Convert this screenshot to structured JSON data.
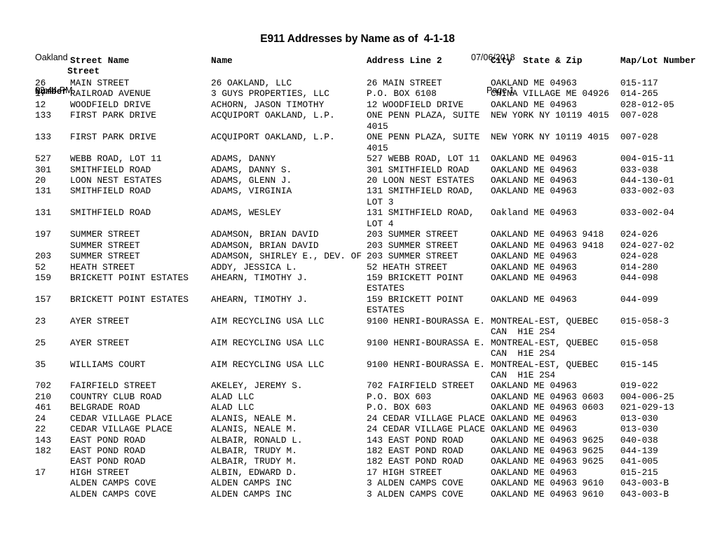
{
  "header": {
    "org": "Oakland",
    "time": "02:44 PM",
    "title": "E911 Addresses by Name as of  4-1-18",
    "run_date": "07/06/2018",
    "page_label": "Page 1"
  },
  "columns": {
    "street_number_line1": "Street",
    "street_number_line2": "Number",
    "street_name": "Street Name",
    "name": "Name",
    "address_line_2": "Address Line 2",
    "city_state_zip": "City  State & Zip",
    "map_lot_number": "Map/Lot Number"
  },
  "rows": [
    {
      "street_number": "26",
      "street_name": "MAIN STREET",
      "name": "26 OAKLAND, LLC",
      "address_line_2": "26 MAIN STREET",
      "city_state_zip": "OAKLAND ME 04963",
      "map_lot": "015-117",
      "lines": 1
    },
    {
      "street_number": "17",
      "street_name": "RAILROAD AVENUE",
      "name": "3 GUYS PROPERTIES, LLC",
      "address_line_2": "P.O. BOX 6108",
      "city_state_zip": "CHINA VILLAGE ME 04926",
      "map_lot": "014-265",
      "lines": 1
    },
    {
      "street_number": "12",
      "street_name": "WOODFIELD DRIVE",
      "name": "ACHORN, JASON TIMOTHY",
      "address_line_2": "12 WOODFIELD DRIVE",
      "city_state_zip": "OAKLAND ME 04963",
      "map_lot": "028-012-05",
      "lines": 1
    },
    {
      "street_number": "133",
      "street_name": "FIRST PARK DRIVE",
      "name": "ACQUIPORT OAKLAND, L.P.",
      "address_line_2": "ONE PENN PLAZA, SUITE 4015",
      "city_state_zip": "NEW YORK NY 10119 4015",
      "map_lot": "007-028",
      "lines": 2
    },
    {
      "street_number": "133",
      "street_name": "FIRST PARK DRIVE",
      "name": "ACQUIPORT OAKLAND, L.P.",
      "address_line_2": "ONE PENN PLAZA, SUITE 4015",
      "city_state_zip": "NEW YORK NY 10119 4015",
      "map_lot": "007-028",
      "lines": 2
    },
    {
      "street_number": "527",
      "street_name": "WEBB ROAD, LOT 11",
      "name": "ADAMS, DANNY",
      "address_line_2": "527 WEBB ROAD, LOT 11",
      "city_state_zip": "OAKLAND ME 04963",
      "map_lot": "004-015-11",
      "lines": 1
    },
    {
      "street_number": "301",
      "street_name": "SMITHFIELD ROAD",
      "name": "ADAMS, DANNY S.",
      "address_line_2": "301 SMITHFIELD ROAD",
      "city_state_zip": "OAKLAND ME 04963",
      "map_lot": "033-038",
      "lines": 1
    },
    {
      "street_number": "20",
      "street_name": "LOON NEST ESTATES",
      "name": "ADAMS, GLENN J.",
      "address_line_2": "20 LOON NEST ESTATES",
      "city_state_zip": "OAKLAND ME 04963",
      "map_lot": "044-130-01",
      "lines": 1
    },
    {
      "street_number": "131",
      "street_name": "SMITHFIELD ROAD",
      "name": "ADAMS, VIRGINIA",
      "address_line_2": "131 SMITHFIELD ROAD, LOT 3",
      "city_state_zip": "OAKLAND ME 04963",
      "map_lot": "033-002-03",
      "lines": 2
    },
    {
      "street_number": "131",
      "street_name": "SMITHFIELD ROAD",
      "name": "ADAMS, WESLEY",
      "address_line_2": "131 SMITHFIELD ROAD, LOT 4",
      "city_state_zip": "Oakland ME 04963",
      "map_lot": "033-002-04",
      "lines": 2
    },
    {
      "street_number": "197",
      "street_name": "SUMMER STREET",
      "name": "ADAMSON, BRIAN DAVID",
      "address_line_2": "203 SUMMER STREET",
      "city_state_zip": "OAKLAND ME 04963 9418",
      "map_lot": "024-026",
      "lines": 1
    },
    {
      "street_number": "",
      "street_name": "SUMMER STREET",
      "name": "ADAMSON, BRIAN DAVID",
      "address_line_2": "203 SUMMER STREET",
      "city_state_zip": "OAKLAND ME 04963 9418",
      "map_lot": "024-027-02",
      "lines": 1
    },
    {
      "street_number": "203",
      "street_name": "SUMMER STREET",
      "name": "ADAMSON, SHIRLEY E., DEV. OF",
      "address_line_2": "203 SUMMER STREET",
      "city_state_zip": "OAKLAND ME 04963",
      "map_lot": "024-028",
      "lines": 1
    },
    {
      "street_number": "52",
      "street_name": "HEATH STREET",
      "name": "ADDY, JESSICA L.",
      "address_line_2": "52 HEATH STREET",
      "city_state_zip": "OAKLAND ME 04963",
      "map_lot": "014-280",
      "lines": 1
    },
    {
      "street_number": "159",
      "street_name": "BRICKETT POINT ESTATES",
      "name": "AHEARN, TIMOTHY J.",
      "address_line_2": "159 BRICKETT POINT ESTATES",
      "city_state_zip": "OAKLAND ME 04963",
      "map_lot": "044-098",
      "lines": 2
    },
    {
      "street_number": "157",
      "street_name": "BRICKETT POINT ESTATES",
      "name": "AHEARN, TIMOTHY J.",
      "address_line_2": "159 BRICKETT POINT ESTATES",
      "city_state_zip": "OAKLAND ME 04963",
      "map_lot": "044-099",
      "lines": 2
    },
    {
      "street_number": "23",
      "street_name": "AYER STREET",
      "name": "AIM RECYCLING USA LLC",
      "address_line_2": "9100 HENRI-BOURASSA E.",
      "city_state_zip": "MONTREAL-EST, QUEBEC CAN  H1E 2S4",
      "map_lot": "015-058-3",
      "lines": 2
    },
    {
      "street_number": "25",
      "street_name": "AYER STREET",
      "name": "AIM RECYCLING USA LLC",
      "address_line_2": "9100 HENRI-BOURASSA E.",
      "city_state_zip": "MONTREAL-EST, QUEBEC CAN  H1E 2S4",
      "map_lot": "015-058",
      "lines": 2
    },
    {
      "street_number": "35",
      "street_name": "WILLIAMS COURT",
      "name": "AIM RECYCLING USA LLC",
      "address_line_2": "9100 HENRI-BOURASSA E.",
      "city_state_zip": "MONTREAL-EST, QUEBEC CAN  H1E 2S4",
      "map_lot": "015-145",
      "lines": 2
    },
    {
      "street_number": "702",
      "street_name": "FAIRFIELD STREET",
      "name": "AKELEY, JEREMY S.",
      "address_line_2": "702 FAIRFIELD STREET",
      "city_state_zip": "OAKLAND ME 04963",
      "map_lot": "019-022",
      "lines": 1
    },
    {
      "street_number": "210",
      "street_name": "COUNTRY CLUB ROAD",
      "name": "ALAD LLC",
      "address_line_2": "P.O. BOX 603",
      "city_state_zip": "OAKLAND ME 04963 0603",
      "map_lot": "004-006-25",
      "lines": 1
    },
    {
      "street_number": "461",
      "street_name": "BELGRADE ROAD",
      "name": "ALAD LLC",
      "address_line_2": "P.O. BOX 603",
      "city_state_zip": "OAKLAND ME 04963 0603",
      "map_lot": "021-029-13",
      "lines": 1
    },
    {
      "street_number": "24",
      "street_name": "CEDAR VILLAGE PLACE",
      "name": "ALANIS, NEALE M.",
      "address_line_2": "24 CEDAR VILLAGE PLACE",
      "city_state_zip": "OAKLAND ME 04963",
      "map_lot": "013-030",
      "lines": 1
    },
    {
      "street_number": "22",
      "street_name": "CEDAR VILLAGE PLACE",
      "name": "ALANIS, NEALE M.",
      "address_line_2": "24 CEDAR VILLAGE PLACE",
      "city_state_zip": "OAKLAND ME 04963",
      "map_lot": "013-030",
      "lines": 1
    },
    {
      "street_number": "143",
      "street_name": "EAST POND ROAD",
      "name": "ALBAIR, RONALD L.",
      "address_line_2": "143 EAST POND ROAD",
      "city_state_zip": "OAKLAND ME 04963 9625",
      "map_lot": "040-038",
      "lines": 1
    },
    {
      "street_number": "182",
      "street_name": "EAST POND ROAD",
      "name": "ALBAIR, TRUDY M.",
      "address_line_2": "182 EAST POND ROAD",
      "city_state_zip": "OAKLAND ME 04963 9625",
      "map_lot": "044-139",
      "lines": 1
    },
    {
      "street_number": "",
      "street_name": "EAST POND ROAD",
      "name": "ALBAIR, TRUDY M.",
      "address_line_2": "182 EAST POND ROAD",
      "city_state_zip": "OAKLAND ME 04963 9625",
      "map_lot": "041-005",
      "lines": 1
    },
    {
      "street_number": "17",
      "street_name": "HIGH STREET",
      "name": "ALBIN, EDWARD D.",
      "address_line_2": "17 HIGH STREET",
      "city_state_zip": "OAKLAND ME 04963",
      "map_lot": "015-215",
      "lines": 1
    },
    {
      "street_number": "",
      "street_name": "ALDEN CAMPS COVE",
      "name": "ALDEN CAMPS INC",
      "address_line_2": "3 ALDEN CAMPS COVE",
      "city_state_zip": "OAKLAND ME 04963 9610",
      "map_lot": "043-003-B",
      "lines": 1
    },
    {
      "street_number": "",
      "street_name": "ALDEN CAMPS COVE",
      "name": "ALDEN CAMPS INC",
      "address_line_2": "3 ALDEN CAMPS COVE",
      "city_state_zip": "OAKLAND ME 04963 9610",
      "map_lot": "043-003-B",
      "lines": 1
    }
  ]
}
